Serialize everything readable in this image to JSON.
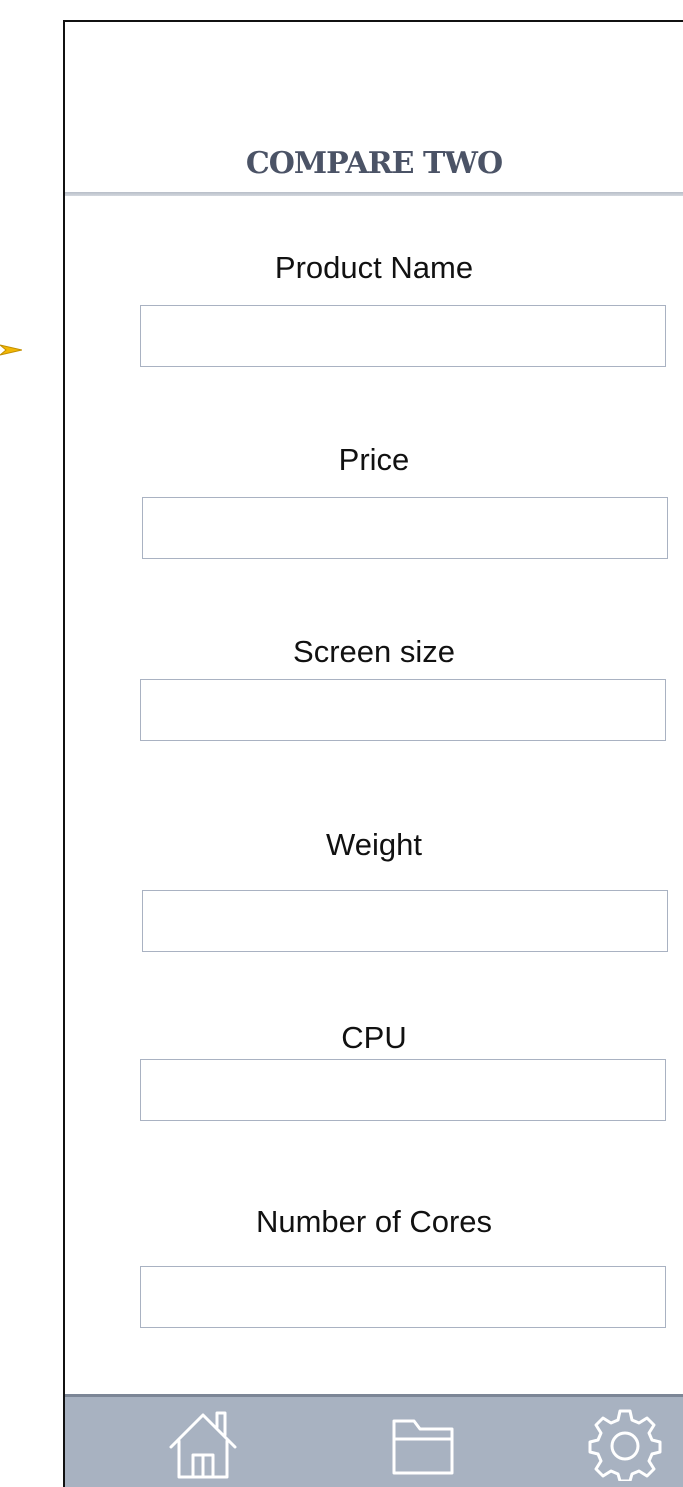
{
  "header": {
    "title": "COMPARE TWO"
  },
  "form": {
    "fields": [
      {
        "label": "Product Name",
        "value": "",
        "placeholder": ""
      },
      {
        "label": "Price",
        "value": "",
        "placeholder": ""
      },
      {
        "label": "Screen size",
        "value": "",
        "placeholder": ""
      },
      {
        "label": "Weight",
        "value": "",
        "placeholder": ""
      },
      {
        "label": "CPU",
        "value": "",
        "placeholder": ""
      },
      {
        "label": "Number of Cores",
        "value": "",
        "placeholder": ""
      }
    ]
  },
  "bottom_nav": {
    "items": [
      {
        "icon": "home-icon"
      },
      {
        "icon": "folder-icon"
      },
      {
        "icon": "gear-icon"
      }
    ]
  },
  "colors": {
    "title": "#4b5366",
    "input_border": "#a9b2c2",
    "nav_background": "#a8b2c1",
    "arrow": "#f2b705"
  }
}
